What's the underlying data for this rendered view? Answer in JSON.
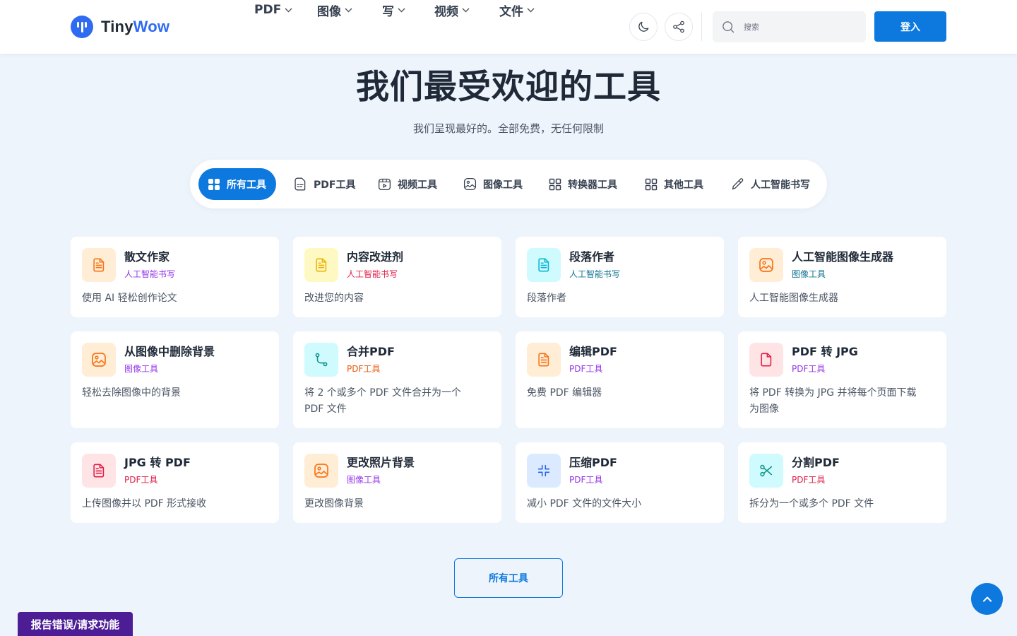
{
  "header": {
    "logo": {
      "part1": "Tiny",
      "part2": "Wow"
    },
    "nav": [
      {
        "label": "PDF"
      },
      {
        "label": "图像"
      },
      {
        "label": "写"
      },
      {
        "label": "视频"
      },
      {
        "label": "文件"
      }
    ],
    "theme_toggle_icon": "moon-icon",
    "share_icon": "share-icon",
    "search": {
      "placeholder": "搜索",
      "value": ""
    },
    "login_label": "登入"
  },
  "hero": {
    "title": "我们最受欢迎的工具",
    "subtitle": "我们呈现最好的。全部免费，无任何限制"
  },
  "tabs": [
    {
      "label": "所有工具",
      "icon": "grid-icon",
      "active": true
    },
    {
      "label": "PDF工具",
      "icon": "pdf-file-icon"
    },
    {
      "label": "视频工具",
      "icon": "video-icon"
    },
    {
      "label": "图像工具",
      "icon": "image-icon"
    },
    {
      "label": "转换器工具",
      "icon": "grid-outline-icon"
    },
    {
      "label": "其他工具",
      "icon": "grid-outline-icon"
    },
    {
      "label": "人工智能书写",
      "icon": "pencil-icon"
    }
  ],
  "cards": [
    {
      "title": "散文作家",
      "category": "人工智能书写",
      "description": "使用 AI 轻松创作论文",
      "icon": "document-icon",
      "icon_color": "#f97316",
      "icon_bg": "#ffedd5",
      "category_color": "#9333ea"
    },
    {
      "title": "内容改进剂",
      "category": "人工智能书写",
      "description": "改进您的内容",
      "icon": "document-icon",
      "icon_color": "#eab308",
      "icon_bg": "#fef9c3",
      "category_color": "#e11d48"
    },
    {
      "title": "段落作者",
      "category": "人工智能书写",
      "description": "段落作者",
      "icon": "document-icon",
      "icon_color": "#06b6d4",
      "icon_bg": "#cffafe",
      "category_color": "#0e7490"
    },
    {
      "title": "人工智能图像生成器",
      "category": "图像工具",
      "description": "人工智能图像生成器",
      "icon": "image-icon",
      "icon_color": "#f97316",
      "icon_bg": "#ffedd5",
      "category_color": "#0e7490"
    },
    {
      "title": "从图像中删除背景",
      "category": "图像工具",
      "description": "轻松去除图像中的背景",
      "icon": "image-icon",
      "icon_color": "#f97316",
      "icon_bg": "#ffedd5",
      "category_color": "#9333ea"
    },
    {
      "title": "合并PDF",
      "category": "PDF工具",
      "description": "将 2 个或多个 PDF 文件合并为一个 PDF 文件",
      "icon": "merge-icon",
      "icon_color": "#0d9488",
      "icon_bg": "#cffafe",
      "category_color": "#ea580c"
    },
    {
      "title": "编辑PDF",
      "category": "PDF工具",
      "description": "免费 PDF 编辑器",
      "icon": "document-icon",
      "icon_color": "#f97316",
      "icon_bg": "#ffedd5",
      "category_color": "#9333ea"
    },
    {
      "title": "PDF 转 JPG",
      "category": "PDF工具",
      "description": "将 PDF 转换为 JPG 并将每个页面下载为图像",
      "icon": "file-icon",
      "icon_color": "#e11d48",
      "icon_bg": "#ffe4e6",
      "category_color": "#9333ea"
    },
    {
      "title": "JPG 转 PDF",
      "category": "PDF工具",
      "description": "上传图像并以 PDF 形式接收",
      "icon": "document-icon",
      "icon_color": "#e11d48",
      "icon_bg": "#ffe4e6",
      "category_color": "#e11d48"
    },
    {
      "title": "更改照片背景",
      "category": "图像工具",
      "description": "更改图像背景",
      "icon": "image-icon",
      "icon_color": "#f97316",
      "icon_bg": "#ffedd5",
      "category_color": "#9333ea"
    },
    {
      "title": "压缩PDF",
      "category": "PDF工具",
      "description": "减小 PDF 文件的文件大小",
      "icon": "compress-icon",
      "icon_color": "#2563eb",
      "icon_bg": "#dbeafe",
      "category_color": "#9333ea"
    },
    {
      "title": "分割PDF",
      "category": "PDF工具",
      "description": "拆分为一个或多个 PDF 文件",
      "icon": "scissors-icon",
      "icon_color": "#0d9488",
      "icon_bg": "#cffafe",
      "category_color": "#e11d48"
    }
  ],
  "all_tools_button": "所有工具",
  "report_button": "报告错误/请求功能",
  "scroll_top_icon": "chevron-up-icon"
}
